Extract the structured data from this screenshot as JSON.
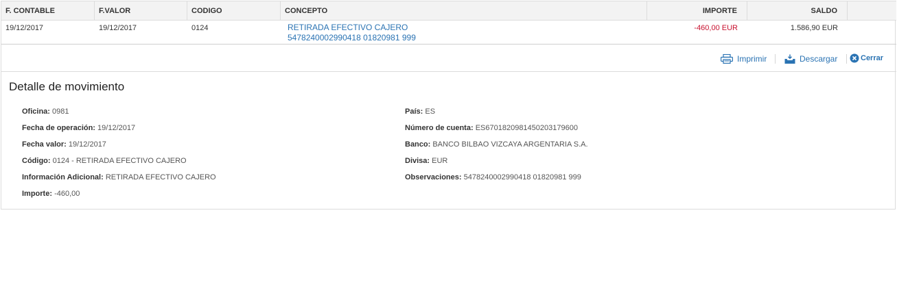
{
  "table": {
    "headers": {
      "f_contable": "F. CONTABLE",
      "f_valor": "F.VALOR",
      "codigo": "CODIGO",
      "concepto": "CONCEPTO",
      "importe": "IMPORTE",
      "saldo": "SALDO"
    },
    "row": {
      "f_contable": "19/12/2017",
      "f_valor": "19/12/2017",
      "codigo": "0124",
      "concepto_line1": "RETIRADA EFECTIVO CAJERO",
      "concepto_line2": "5478240002990418 01820981 999",
      "importe": "-460,00 EUR",
      "saldo": "1.586,90 EUR"
    }
  },
  "actions": {
    "print_label": "Imprimir",
    "download_label": "Descargar",
    "close_label": "Cerrar"
  },
  "detail": {
    "title": "Detalle de movimiento",
    "left": [
      {
        "label": "Oficina:",
        "value": "0981"
      },
      {
        "label": "Fecha de operación:",
        "value": "19/12/2017"
      },
      {
        "label": "Fecha valor:",
        "value": "19/12/2017"
      },
      {
        "label": "Código:",
        "value": "0124 - RETIRADA EFECTIVO CAJERO"
      },
      {
        "label": "Información Adicional:",
        "value": "RETIRADA EFECTIVO CAJERO"
      },
      {
        "label": "Importe:",
        "value": "-460,00"
      }
    ],
    "right": [
      {
        "label": "País:",
        "value": "ES"
      },
      {
        "label": "Número de cuenta:",
        "value": "ES6701820981450203179600"
      },
      {
        "label": "Banco:",
        "value": "BANCO BILBAO VIZCAYA ARGENTARIA S.A."
      },
      {
        "label": "Divisa:",
        "value": "EUR"
      },
      {
        "label": "Observaciones:",
        "value": "5478240002990418 01820981 999"
      }
    ]
  },
  "colors": {
    "link": "#2a73b3",
    "negative": "#c8102e",
    "header_bg": "#f3f3f3"
  },
  "icons": {
    "print": "printer-icon",
    "download": "download-tray-icon",
    "close": "close-circle-icon"
  }
}
